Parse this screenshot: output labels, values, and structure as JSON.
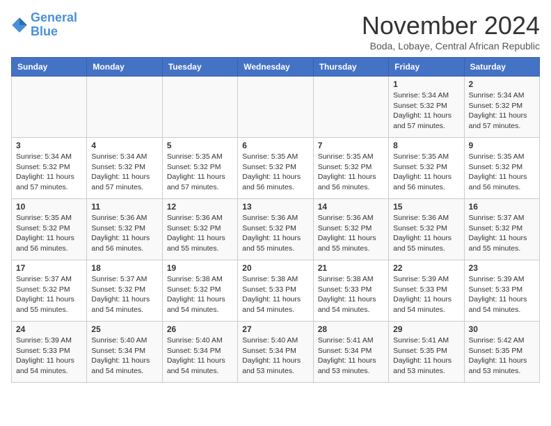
{
  "logo": {
    "line1": "General",
    "line2": "Blue"
  },
  "title": "November 2024",
  "location": "Boda, Lobaye, Central African Republic",
  "days_of_week": [
    "Sunday",
    "Monday",
    "Tuesday",
    "Wednesday",
    "Thursday",
    "Friday",
    "Saturday"
  ],
  "weeks": [
    [
      {
        "day": "",
        "info": ""
      },
      {
        "day": "",
        "info": ""
      },
      {
        "day": "",
        "info": ""
      },
      {
        "day": "",
        "info": ""
      },
      {
        "day": "",
        "info": ""
      },
      {
        "day": "1",
        "info": "Sunrise: 5:34 AM\nSunset: 5:32 PM\nDaylight: 11 hours\nand 57 minutes."
      },
      {
        "day": "2",
        "info": "Sunrise: 5:34 AM\nSunset: 5:32 PM\nDaylight: 11 hours\nand 57 minutes."
      }
    ],
    [
      {
        "day": "3",
        "info": "Sunrise: 5:34 AM\nSunset: 5:32 PM\nDaylight: 11 hours\nand 57 minutes."
      },
      {
        "day": "4",
        "info": "Sunrise: 5:34 AM\nSunset: 5:32 PM\nDaylight: 11 hours\nand 57 minutes."
      },
      {
        "day": "5",
        "info": "Sunrise: 5:35 AM\nSunset: 5:32 PM\nDaylight: 11 hours\nand 57 minutes."
      },
      {
        "day": "6",
        "info": "Sunrise: 5:35 AM\nSunset: 5:32 PM\nDaylight: 11 hours\nand 56 minutes."
      },
      {
        "day": "7",
        "info": "Sunrise: 5:35 AM\nSunset: 5:32 PM\nDaylight: 11 hours\nand 56 minutes."
      },
      {
        "day": "8",
        "info": "Sunrise: 5:35 AM\nSunset: 5:32 PM\nDaylight: 11 hours\nand 56 minutes."
      },
      {
        "day": "9",
        "info": "Sunrise: 5:35 AM\nSunset: 5:32 PM\nDaylight: 11 hours\nand 56 minutes."
      }
    ],
    [
      {
        "day": "10",
        "info": "Sunrise: 5:35 AM\nSunset: 5:32 PM\nDaylight: 11 hours\nand 56 minutes."
      },
      {
        "day": "11",
        "info": "Sunrise: 5:36 AM\nSunset: 5:32 PM\nDaylight: 11 hours\nand 56 minutes."
      },
      {
        "day": "12",
        "info": "Sunrise: 5:36 AM\nSunset: 5:32 PM\nDaylight: 11 hours\nand 55 minutes."
      },
      {
        "day": "13",
        "info": "Sunrise: 5:36 AM\nSunset: 5:32 PM\nDaylight: 11 hours\nand 55 minutes."
      },
      {
        "day": "14",
        "info": "Sunrise: 5:36 AM\nSunset: 5:32 PM\nDaylight: 11 hours\nand 55 minutes."
      },
      {
        "day": "15",
        "info": "Sunrise: 5:36 AM\nSunset: 5:32 PM\nDaylight: 11 hours\nand 55 minutes."
      },
      {
        "day": "16",
        "info": "Sunrise: 5:37 AM\nSunset: 5:32 PM\nDaylight: 11 hours\nand 55 minutes."
      }
    ],
    [
      {
        "day": "17",
        "info": "Sunrise: 5:37 AM\nSunset: 5:32 PM\nDaylight: 11 hours\nand 55 minutes."
      },
      {
        "day": "18",
        "info": "Sunrise: 5:37 AM\nSunset: 5:32 PM\nDaylight: 11 hours\nand 54 minutes."
      },
      {
        "day": "19",
        "info": "Sunrise: 5:38 AM\nSunset: 5:32 PM\nDaylight: 11 hours\nand 54 minutes."
      },
      {
        "day": "20",
        "info": "Sunrise: 5:38 AM\nSunset: 5:33 PM\nDaylight: 11 hours\nand 54 minutes."
      },
      {
        "day": "21",
        "info": "Sunrise: 5:38 AM\nSunset: 5:33 PM\nDaylight: 11 hours\nand 54 minutes."
      },
      {
        "day": "22",
        "info": "Sunrise: 5:39 AM\nSunset: 5:33 PM\nDaylight: 11 hours\nand 54 minutes."
      },
      {
        "day": "23",
        "info": "Sunrise: 5:39 AM\nSunset: 5:33 PM\nDaylight: 11 hours\nand 54 minutes."
      }
    ],
    [
      {
        "day": "24",
        "info": "Sunrise: 5:39 AM\nSunset: 5:33 PM\nDaylight: 11 hours\nand 54 minutes."
      },
      {
        "day": "25",
        "info": "Sunrise: 5:40 AM\nSunset: 5:34 PM\nDaylight: 11 hours\nand 54 minutes."
      },
      {
        "day": "26",
        "info": "Sunrise: 5:40 AM\nSunset: 5:34 PM\nDaylight: 11 hours\nand 54 minutes."
      },
      {
        "day": "27",
        "info": "Sunrise: 5:40 AM\nSunset: 5:34 PM\nDaylight: 11 hours\nand 53 minutes."
      },
      {
        "day": "28",
        "info": "Sunrise: 5:41 AM\nSunset: 5:34 PM\nDaylight: 11 hours\nand 53 minutes."
      },
      {
        "day": "29",
        "info": "Sunrise: 5:41 AM\nSunset: 5:35 PM\nDaylight: 11 hours\nand 53 minutes."
      },
      {
        "day": "30",
        "info": "Sunrise: 5:42 AM\nSunset: 5:35 PM\nDaylight: 11 hours\nand 53 minutes."
      }
    ]
  ]
}
